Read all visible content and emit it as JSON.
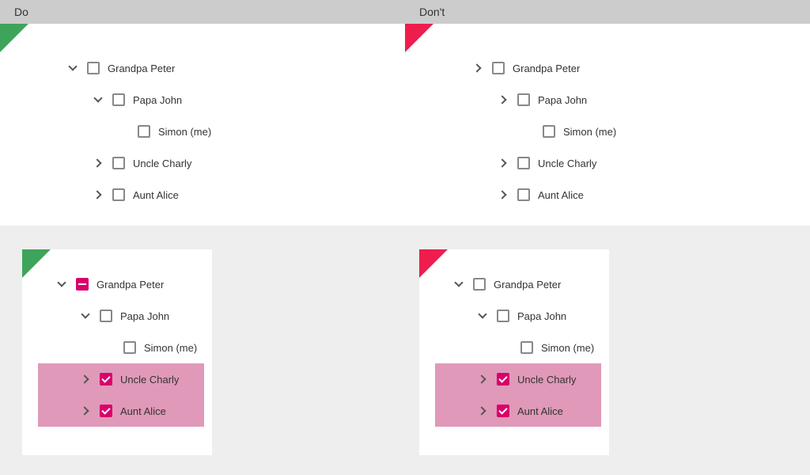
{
  "header": {
    "do": "Do",
    "dont": "Don't"
  },
  "colors": {
    "do": "#3fa45b",
    "dont": "#ee1d4e",
    "accent": "#d9006c",
    "highlight": "#e099b9"
  },
  "examples": {
    "row1": {
      "do": {
        "nodes": [
          {
            "label": "Grandpa Peter",
            "level": 0,
            "expanded": true,
            "hasChildren": true,
            "state": "unchecked",
            "highlight": false
          },
          {
            "label": "Papa John",
            "level": 1,
            "expanded": true,
            "hasChildren": true,
            "state": "unchecked",
            "highlight": false
          },
          {
            "label": "Simon (me)",
            "level": 2,
            "expanded": false,
            "hasChildren": false,
            "state": "unchecked",
            "highlight": false
          },
          {
            "label": "Uncle Charly",
            "level": 1,
            "expanded": false,
            "hasChildren": true,
            "state": "unchecked",
            "highlight": false
          },
          {
            "label": "Aunt Alice",
            "level": 1,
            "expanded": false,
            "hasChildren": true,
            "state": "unchecked",
            "highlight": false
          }
        ]
      },
      "dont": {
        "nodes": [
          {
            "label": "Grandpa Peter",
            "level": 0,
            "expanded": false,
            "hasChildren": true,
            "state": "unchecked",
            "highlight": false
          },
          {
            "label": "Papa John",
            "level": 1,
            "expanded": false,
            "hasChildren": true,
            "state": "unchecked",
            "highlight": false
          },
          {
            "label": "Simon (me)",
            "level": 2,
            "expanded": false,
            "hasChildren": false,
            "state": "unchecked",
            "highlight": false
          },
          {
            "label": "Uncle Charly",
            "level": 1,
            "expanded": false,
            "hasChildren": true,
            "state": "unchecked",
            "highlight": false
          },
          {
            "label": "Aunt Alice",
            "level": 1,
            "expanded": false,
            "hasChildren": true,
            "state": "unchecked",
            "highlight": false
          }
        ]
      }
    },
    "row2": {
      "do": {
        "nodes": [
          {
            "label": "Grandpa Peter",
            "level": 0,
            "expanded": true,
            "hasChildren": true,
            "state": "indeterminate",
            "highlight": false
          },
          {
            "label": "Papa John",
            "level": 1,
            "expanded": true,
            "hasChildren": true,
            "state": "unchecked",
            "highlight": false
          },
          {
            "label": "Simon (me)",
            "level": 2,
            "expanded": false,
            "hasChildren": false,
            "state": "unchecked",
            "highlight": false
          },
          {
            "label": "Uncle Charly",
            "level": 1,
            "expanded": false,
            "hasChildren": true,
            "state": "checked",
            "highlight": true
          },
          {
            "label": "Aunt Alice",
            "level": 1,
            "expanded": false,
            "hasChildren": true,
            "state": "checked",
            "highlight": true
          }
        ]
      },
      "dont": {
        "nodes": [
          {
            "label": "Grandpa Peter",
            "level": 0,
            "expanded": true,
            "hasChildren": true,
            "state": "unchecked",
            "highlight": false
          },
          {
            "label": "Papa John",
            "level": 1,
            "expanded": true,
            "hasChildren": true,
            "state": "unchecked",
            "highlight": false
          },
          {
            "label": "Simon (me)",
            "level": 2,
            "expanded": false,
            "hasChildren": false,
            "state": "unchecked",
            "highlight": false
          },
          {
            "label": "Uncle Charly",
            "level": 1,
            "expanded": false,
            "hasChildren": true,
            "state": "checked",
            "highlight": true
          },
          {
            "label": "Aunt Alice",
            "level": 1,
            "expanded": false,
            "hasChildren": true,
            "state": "checked",
            "highlight": true
          }
        ]
      }
    }
  }
}
